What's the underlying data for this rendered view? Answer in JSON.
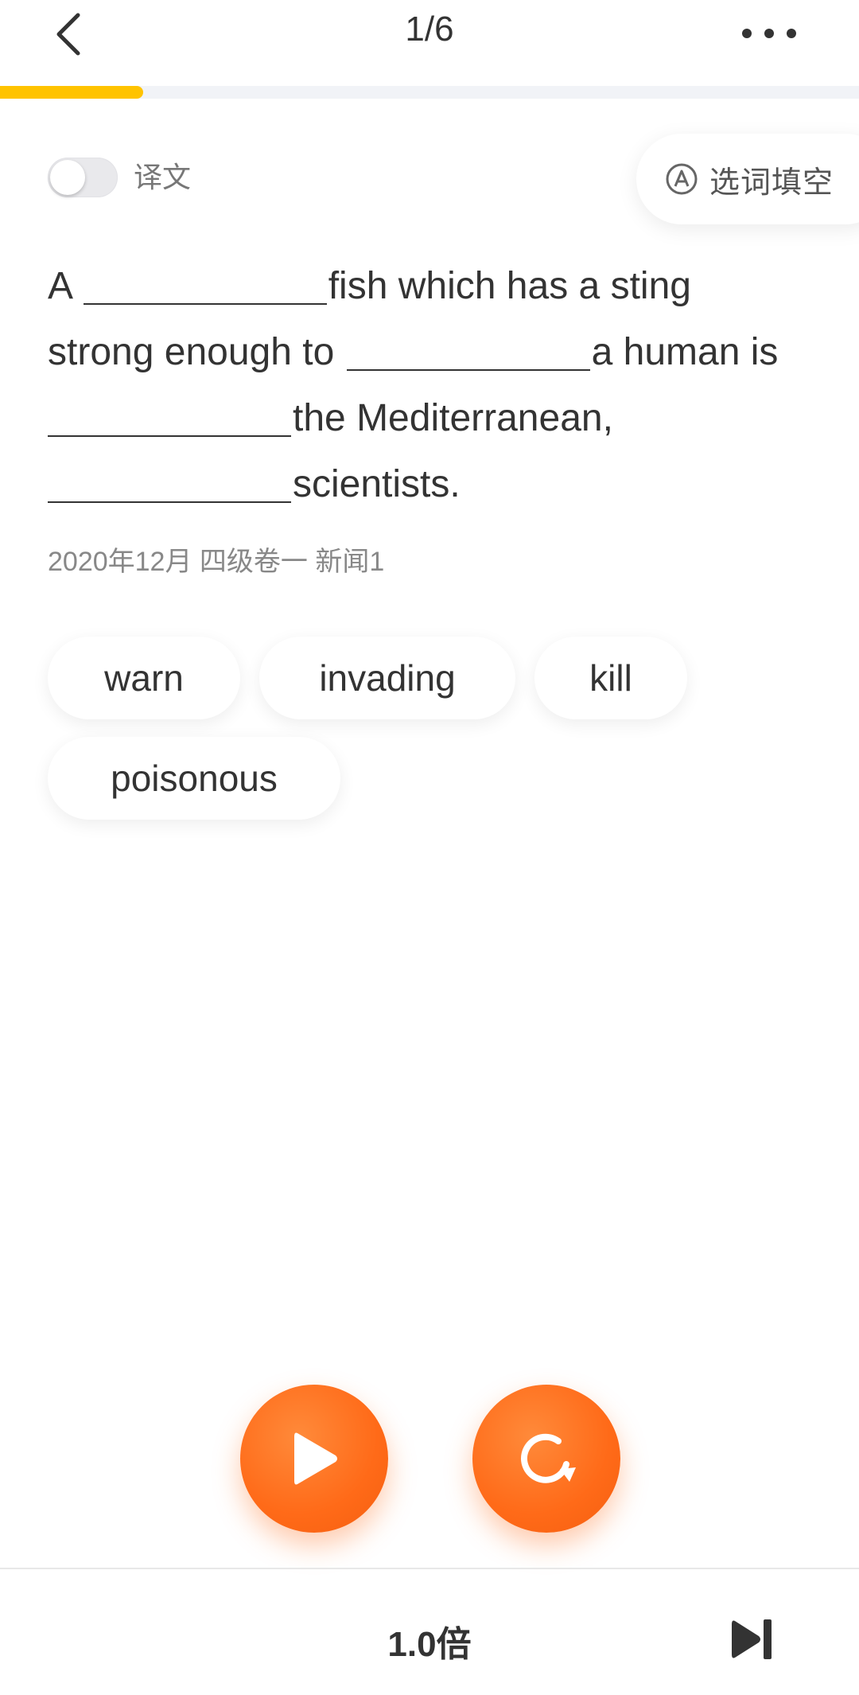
{
  "header": {
    "page_indicator": "1/6",
    "progress_fraction": 0.1667
  },
  "controls": {
    "translation_label": "译文",
    "translation_toggle_on": false,
    "mode_label": "选词填空",
    "mode_icon": "letter-a-circle-icon"
  },
  "question": {
    "segments": {
      "s1": "A",
      "s2": "fish which has a sting",
      "s3": "strong enough to",
      "s4": "a human is",
      "s5": "the Mediterranean,",
      "s6": "scientists."
    },
    "source": "2020年12月 四级卷一 新闻1"
  },
  "word_options": [
    "warn",
    "invading",
    "kill",
    "poisonous"
  ],
  "player": {
    "play_icon": "play-icon",
    "replay_icon": "replay-icon",
    "speed_label": "1.0倍",
    "next_icon": "skip-next-icon"
  },
  "colors": {
    "accent_yellow": "#FFC300",
    "accent_orange": "#FF6A18",
    "text_primary": "#333333",
    "text_secondary": "#888888"
  }
}
